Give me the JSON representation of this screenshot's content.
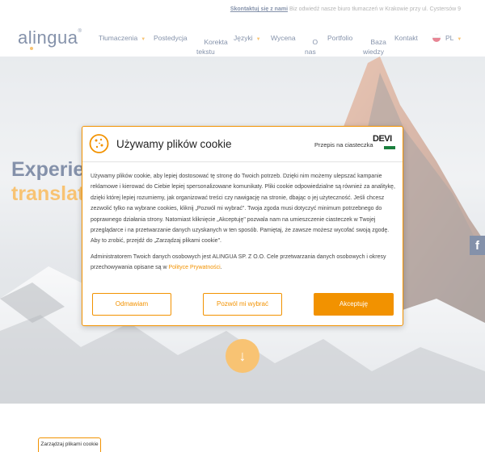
{
  "topbar": {
    "contact_link": "Skontaktuj się z nami",
    "contact_text": "Biz odwiedź naszе biuro tłumaczeń w Krakowie przy ul. Cystersów 9"
  },
  "header": {
    "logo_text": "alingua",
    "nav": [
      {
        "label": "Tłumaczenia",
        "caret": true
      },
      {
        "label": "Postedycja",
        "caret": false
      },
      {
        "label": "Korekta\ntekstu",
        "caret": false
      },
      {
        "label": "Języki",
        "caret": true
      },
      {
        "label": "Wycena",
        "caret": false
      },
      {
        "label": "O\nnas",
        "caret": false
      },
      {
        "label": "Portfolio",
        "caret": false
      },
      {
        "label": "Baza\nwiedzy",
        "caret": false
      },
      {
        "label": "Kontakt",
        "caret": false
      }
    ],
    "language": "PL"
  },
  "hero": {
    "title_line1": "Experien",
    "title_line2": "translat",
    "scroll_icon": "arrow-down-icon",
    "facebook_label": "f"
  },
  "cookie_modal": {
    "title": "Używamy plików cookie",
    "privacy_by_label": "Przepis na ciasteczka",
    "provider_logo": "DEVI",
    "paragraph1": "Używamy plików cookie, aby lepiej dostosować tę stronę do Twoich potrzeb. Dzięki nim możemy ulepszać kampanie reklamowe i kierować do Ciebie lepiej spersonalizowane komunikaty. Pliki cookie odpowiedzialne są również za analitykę, dzięki której lepiej rozumiemy, jak organizować treści czy nawigację na stronie, dbając o jej użyteczność. Jeśli chcesz zezwolić tylko na wybrane cookies, kliknij „Pozwól mi wybrać\". Twoja zgoda musi dotyczyć minimum potrzebnego do poprawnego działania strony. Natomiast kliknięcie „Akceptuję\" pozwala nam na umieszczenie ciasteczek w Twojej przeglądarce i na przetwarzanie danych uzyskanych w ten sposób. Pamiętaj, że zawsze możesz wycofać swoją zgodę. Aby to zrobić, przejdź do „Zarządzaj plikami cookie\".",
    "paragraph2_prefix": "Administratorem Twoich danych osobowych jest ALINGUA SP. Z O.O. Cele przetwarzania danych osobowych i okresy przechowywania opisane są w ",
    "privacy_link": "Polityce Prywatności",
    "paragraph2_suffix": ".",
    "buttons": {
      "refuse": "Odmawiam",
      "choose": "Pozwól mi wybrać",
      "accept": "Akceptuję"
    }
  },
  "manage_cookies_label": "Zarządzaj plikami cookie",
  "colors": {
    "accent": "#f29200",
    "brand": "#1f3864"
  }
}
